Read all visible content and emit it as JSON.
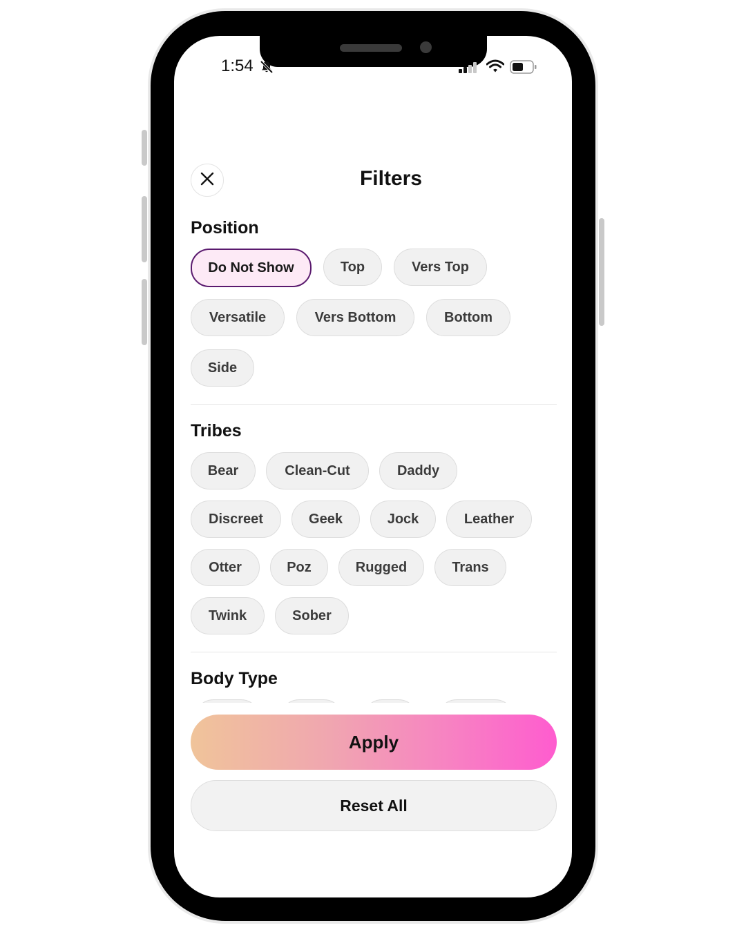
{
  "status_bar": {
    "time": "1:54"
  },
  "header": {
    "title": "Filters"
  },
  "position": {
    "title": "Position",
    "options": [
      "Do Not Show",
      "Top",
      "Vers Top",
      "Versatile",
      "Vers Bottom",
      "Bottom",
      "Side"
    ],
    "selected": "Do Not Show"
  },
  "tribes": {
    "title": "Tribes",
    "options": [
      "Bear",
      "Clean-Cut",
      "Daddy",
      "Discreet",
      "Geek",
      "Jock",
      "Leather",
      "Otter",
      "Poz",
      "Rugged",
      "Trans",
      "Twink",
      "Sober"
    ]
  },
  "body_type": {
    "title": "Body Type"
  },
  "actions": {
    "apply": "Apply",
    "reset": "Reset All"
  },
  "colors": {
    "selected_chip_bg": "#fdeaf6",
    "selected_chip_border": "#5a1a6e",
    "apply_gradient_start": "#f0c49a",
    "apply_gradient_end": "#fe5ccf"
  },
  "icons": {
    "close": "close-icon",
    "mute": "bell-slash-icon",
    "signal": "signal-icon",
    "wifi": "wifi-icon",
    "battery": "battery-icon"
  }
}
